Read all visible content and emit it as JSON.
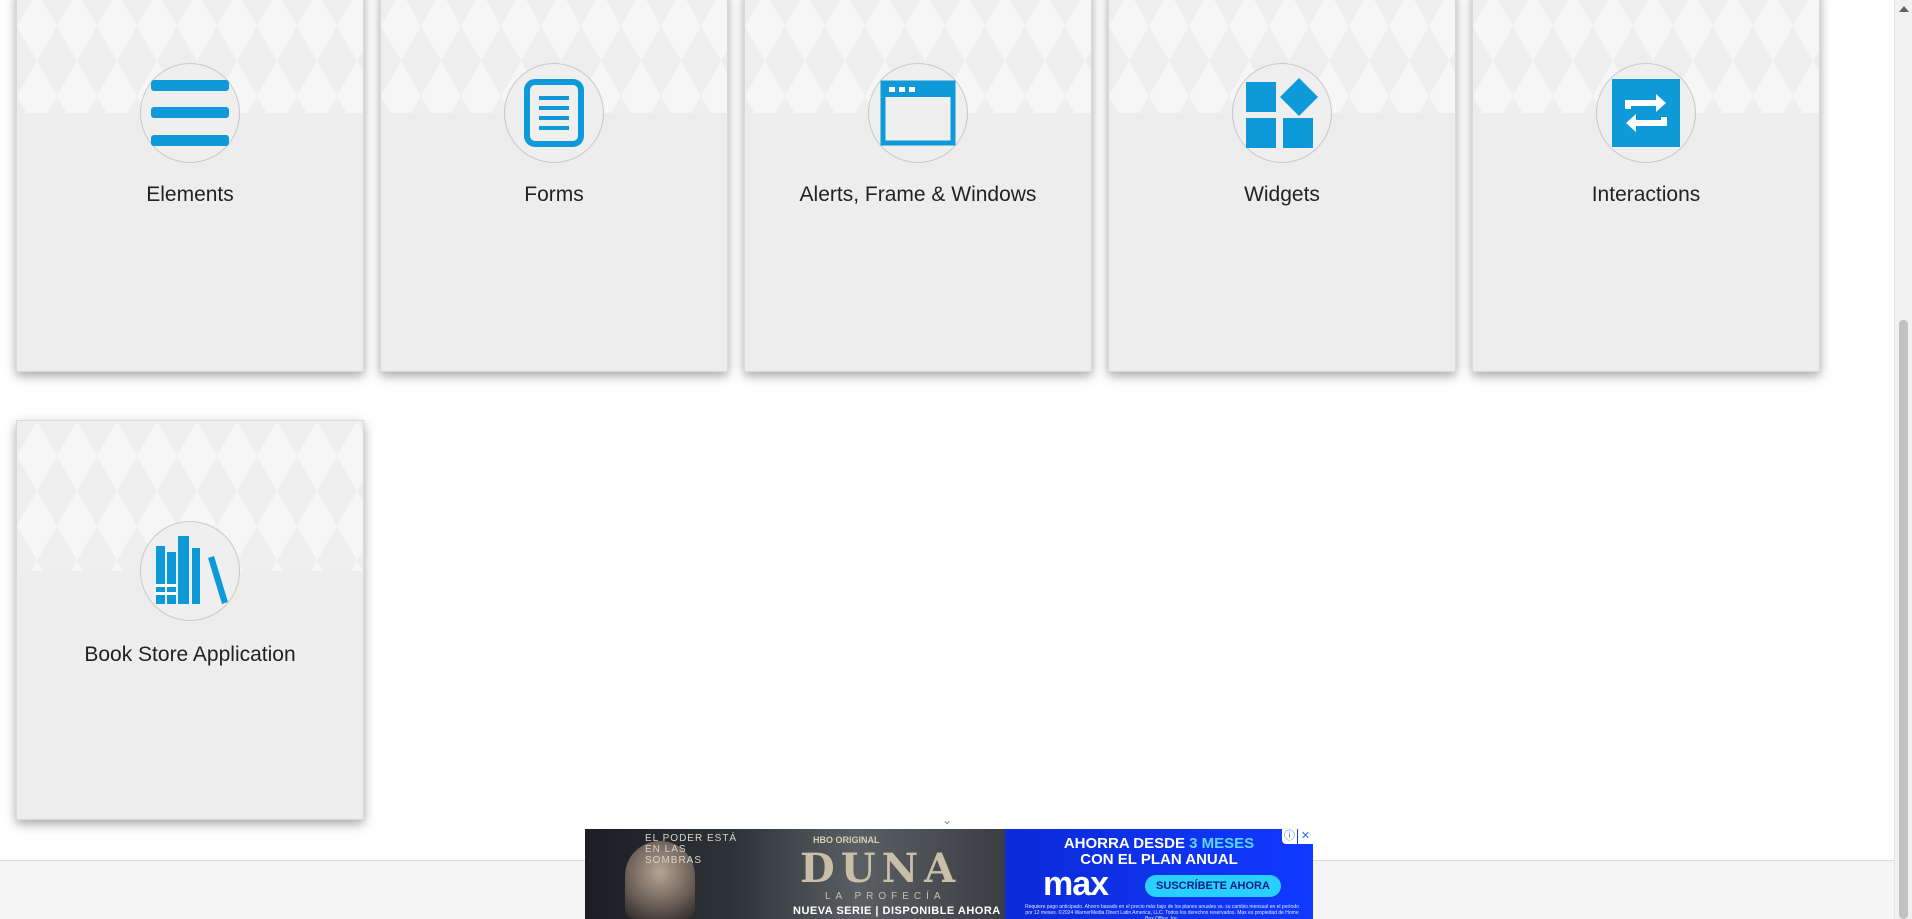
{
  "cards": [
    {
      "title": "Elements",
      "icon": "menu-lines-icon"
    },
    {
      "title": "Forms",
      "icon": "document-form-icon"
    },
    {
      "title": "Alerts, Frame & Windows",
      "icon": "browser-window-icon"
    },
    {
      "title": "Widgets",
      "icon": "widgets-blocks-icon"
    },
    {
      "title": "Interactions",
      "icon": "swap-arrows-icon"
    },
    {
      "title": "Book Store Application",
      "icon": "books-icon"
    }
  ],
  "colors": {
    "accent": "#0e9ad8",
    "card_bg": "#ededed",
    "title_text": "#222222"
  },
  "ad": {
    "tagline": "EL PODER ESTÁ EN LAS SOMBRAS",
    "network": "HBO ORIGINAL",
    "show_title": "DUNA",
    "show_subtitle": "LA PROFECÍA",
    "release": "NUEVA SERIE | DISPONIBLE AHORA",
    "offer_prefix": "AHORRA DESDE",
    "offer_highlight": "3 MESES",
    "offer_line2": "CON EL PLAN ANUAL",
    "brand": "max",
    "cta": "SUSCRÍBETE AHORA",
    "legal": "Requiere pago anticipado. Ahorro basado en el precio más bajo de los planes anuales vs. su cambio mensual en el período por 12 meses. ©2024 WarnerMedia Direct Latin America, LLC. Todos los derechos reservados. Max es propiedad de Home Box Office, Inc.",
    "info_icon": "ⓘ",
    "close_icon": "✕",
    "collapse_icon": "⌄"
  }
}
